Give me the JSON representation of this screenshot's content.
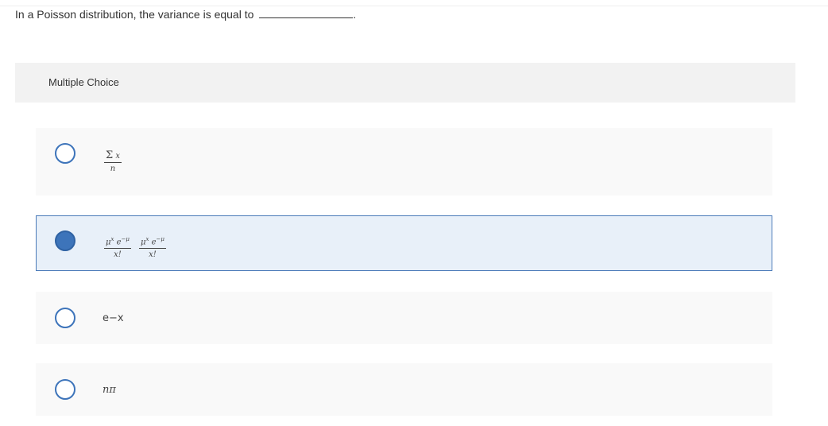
{
  "question": {
    "text": "In a Poisson distribution, the variance is equal to",
    "blank_suffix": "."
  },
  "panel": {
    "header_label": "Multiple Choice"
  },
  "options": [
    {
      "id": "a",
      "selected": false,
      "frac_num_sigma": "Σ",
      "frac_num_var": "x",
      "frac_den": "n"
    },
    {
      "id": "b",
      "selected": true,
      "num_mu": "μ",
      "num_sup_x": "x",
      "num_e": "e",
      "num_sup_neg_mu": "−μ",
      "den": "x!"
    },
    {
      "id": "c",
      "selected": false,
      "text": "e−x"
    },
    {
      "id": "d",
      "selected": false,
      "text": "nπ"
    }
  ],
  "colors": {
    "accent": "#3d74ba",
    "selected_bg": "#e8f0f9",
    "option_bg": "#f9f9f9",
    "header_bg": "#f2f2f2"
  }
}
